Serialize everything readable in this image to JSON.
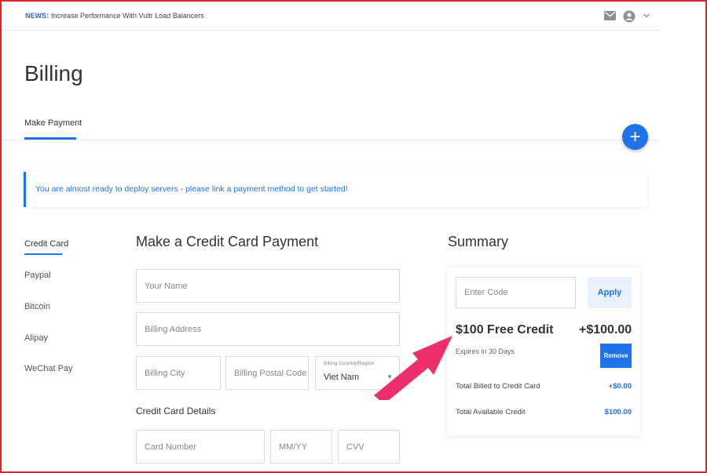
{
  "topbar": {
    "news_label": "NEWS:",
    "news_text": "Increase Performance With Vultr Load Balancers",
    "icons": [
      "mail-icon",
      "user-icon",
      "chevron-down-icon"
    ]
  },
  "page": {
    "title": "Billing",
    "tab": "Make Payment",
    "fab_symbol": "+"
  },
  "alert": {
    "text": "You are almost ready to deploy servers - please link a payment method to get started!"
  },
  "methods": [
    {
      "label": "Credit Card",
      "active": true
    },
    {
      "label": "Paypal",
      "active": false
    },
    {
      "label": "Bitcoin",
      "active": false
    },
    {
      "label": "Alipay",
      "active": false
    },
    {
      "label": "WeChat Pay",
      "active": false
    }
  ],
  "form": {
    "title": "Make a Credit Card Payment",
    "name_placeholder": "Your Name",
    "address_placeholder": "Billing Address",
    "city_placeholder": "Billing City",
    "postal_placeholder": "Billing Postal Code",
    "country_label": "Billing Country/Region",
    "country_value": "Viet Nam",
    "card_section_title": "Credit Card Details",
    "card_number_placeholder": "Card Number",
    "expiry_placeholder": "MM/YY",
    "cvv_placeholder": "CVV"
  },
  "summary": {
    "title": "Summary",
    "code_placeholder": "Enter Code",
    "apply_label": "Apply",
    "credit_title": "$100 Free Credit",
    "credit_amount": "+$100.00",
    "expires": "Expires in 30 Days",
    "remove_label": "Remove",
    "billed_label": "Total Billed to Credit Card",
    "billed_value": "+$0.00",
    "available_label": "Total Available Credit",
    "available_value": "$100.00"
  },
  "colors": {
    "accent": "#1e73e8",
    "annotation_arrow": "#ee2f6b",
    "frame_border": "#d62828"
  }
}
